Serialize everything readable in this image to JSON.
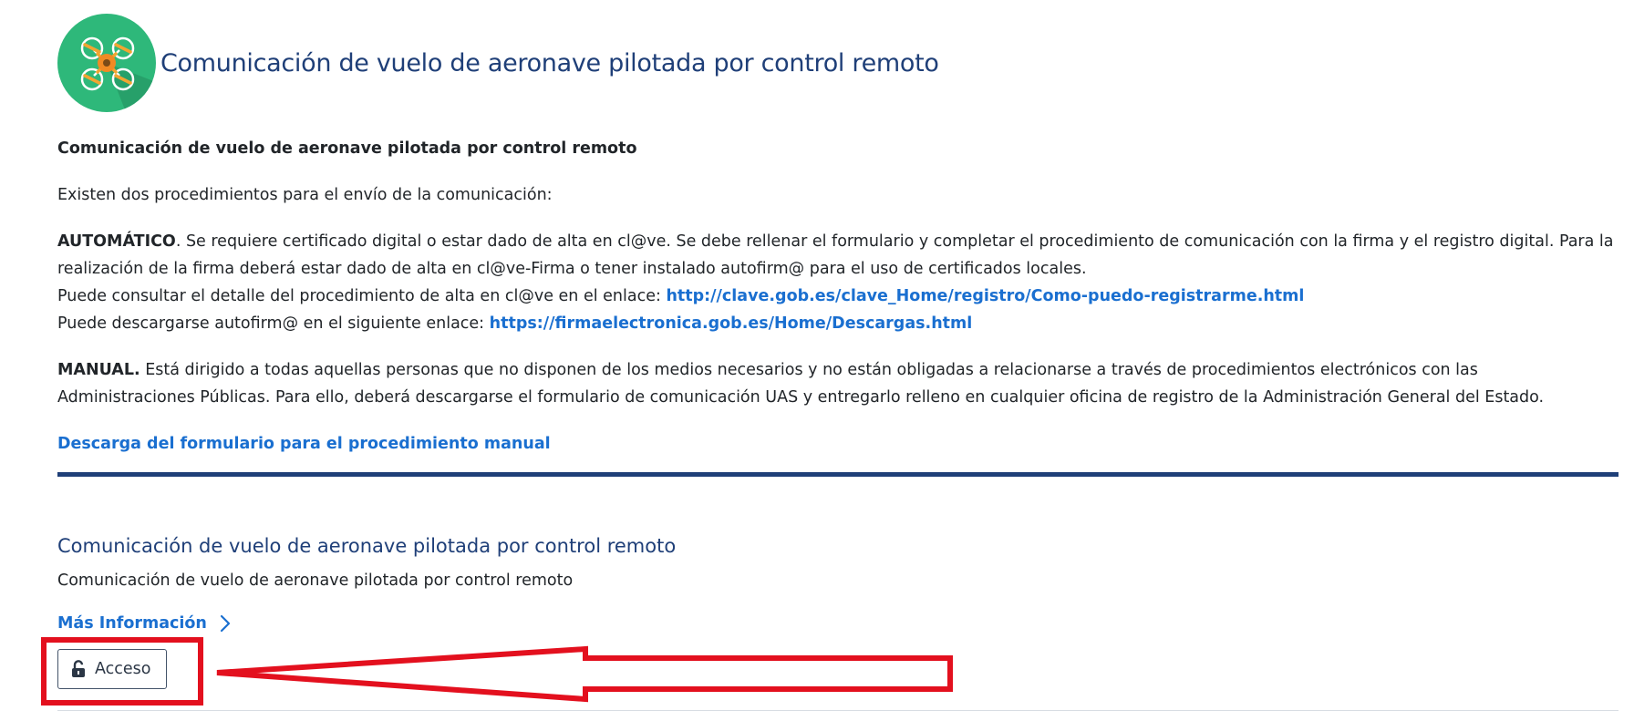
{
  "header": {
    "logo_icon": "drone-icon",
    "title": "Comunicación de vuelo de aeronave pilotada por control remoto"
  },
  "content": {
    "heading": "Comunicación de vuelo de aeronave pilotada por control remoto",
    "intro": "Existen dos procedimientos para el envío de la comunicación:",
    "automatic": {
      "label": "AUTOMÁTICO",
      "text": ". Se requiere certificado digital o estar dado de alta en cl@ve. Se debe rellenar el formulario y completar el procedimiento de comunicación con la firma y el registro digital. Para la realización de la firma deberá estar dado de alta en cl@ve-Firma o tener instalado autofirm@ para el uso de certificados locales.",
      "clave_prefix": "Puede consultar el detalle del procedimiento de alta en cl@ve en el enlace: ",
      "clave_link": "http://clave.gob.es/clave_Home/registro/Como-puedo-registrarme.html",
      "autofirma_prefix": "Puede descargarse autofirm@ en el siguiente enlace: ",
      "autofirma_link": "https://firmaelectronica.gob.es/Home/Descargas.html"
    },
    "manual": {
      "label": "MANUAL.",
      "text": " Está dirigido a todas aquellas personas que no disponen de los medios necesarios y no están obligadas a relacionarse a través de procedimientos electrónicos con las Administraciones Públicas. Para ello, deberá descargarse el formulario de comunicación UAS y entregarlo relleno en cualquier oficina de registro de la Administración General del Estado."
    },
    "download_link": "Descarga del formulario para el procedimiento manual"
  },
  "procedure": {
    "title": "Comunicación de vuelo de aeronave pilotada por control remoto",
    "description": "Comunicación de vuelo de aeronave pilotada por control remoto",
    "more_info": "Más Información",
    "access_button": "Acceso"
  },
  "colors": {
    "brand_blue": "#1f3f78",
    "link_blue": "#1a6fd0",
    "logo_green": "#2eb87a",
    "annotation_red": "#e3101e"
  }
}
